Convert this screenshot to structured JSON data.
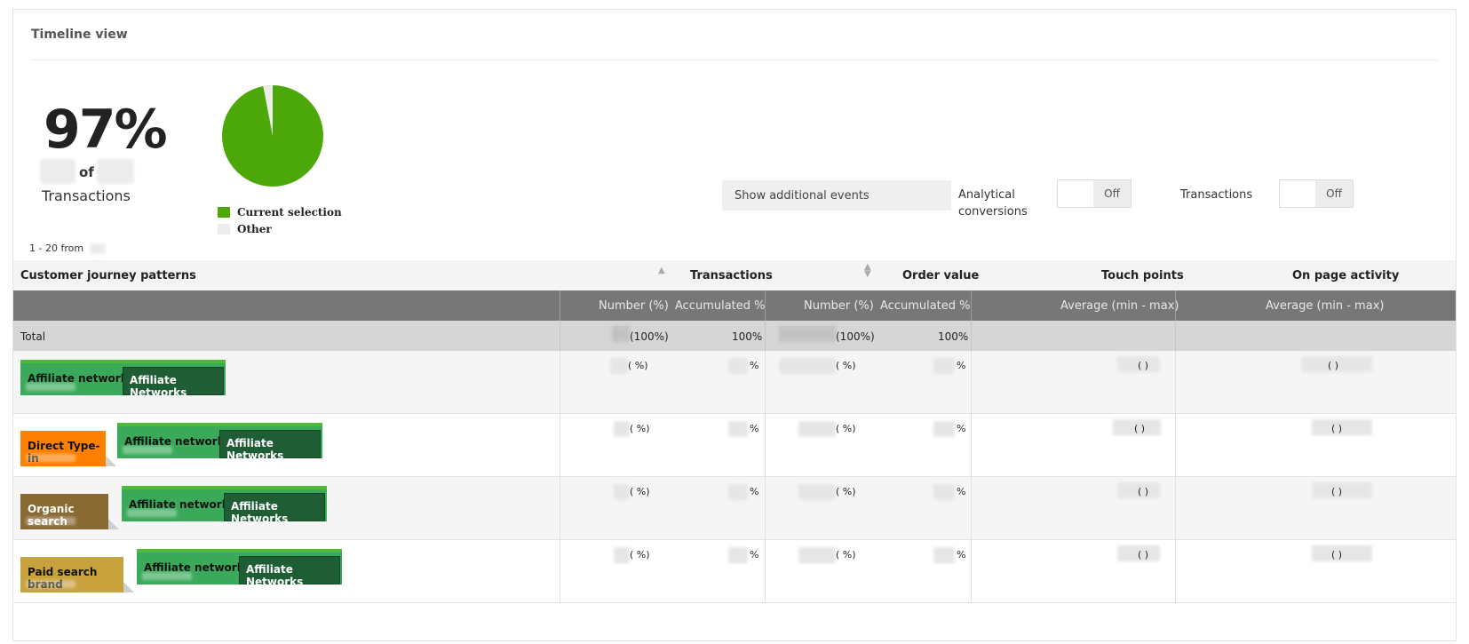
{
  "panel": {
    "title": "Timeline view"
  },
  "summary": {
    "percentage": "97%",
    "of_text": "of",
    "metric_label": "Transactions",
    "range_text": "1 - 20 from"
  },
  "pie_legend": [
    {
      "label": "Current selection",
      "color": "#4ca808"
    },
    {
      "label": "Other",
      "color": "#ececec"
    }
  ],
  "controls": {
    "show_events_label": "Show additional events",
    "toggle1_label": "Analytical conversions",
    "toggle1_state": "Off",
    "toggle2_label": "Transactions",
    "toggle2_state": "Off"
  },
  "table": {
    "group_headers": {
      "patterns": "Customer journey patterns",
      "transactions": "Transactions",
      "order_value": "Order value",
      "touch_points": "Touch points",
      "on_page_activity": "On page activity"
    },
    "sub_headers": {
      "number_pct_1": "Number (%)",
      "accumulated_1": "Accumulated %",
      "number_pct_2": "Number (%)",
      "accumulated_2": "Accumulated %",
      "average_1": "Average (min - max)",
      "average_2": "Average (min - max)"
    },
    "total": {
      "label": "Total",
      "trans_number": "(100%)",
      "trans_accum": "100%",
      "order_number": "(100%)",
      "order_accum": "100%"
    },
    "rows": [
      {
        "chips": [
          {
            "label": "Affiliate networks",
            "inner": "Affiliate Networks"
          }
        ],
        "trans_number": "(   %)",
        "trans_accum": "%",
        "order_number": "(   %)",
        "order_accum": "%",
        "touch": "(   )",
        "activity": "(   )"
      },
      {
        "chips": [
          {
            "label": "Direct Type-in"
          },
          {
            "label": "Affiliate networks",
            "inner": "Affiliate Networks"
          }
        ],
        "trans_number": "(   %)",
        "trans_accum": "%",
        "order_number": "(   %)",
        "order_accum": "%",
        "touch": "(   )",
        "activity": "(   )"
      },
      {
        "chips": [
          {
            "label": "Organic search"
          },
          {
            "label": "Affiliate networks",
            "inner": "Affiliate Networks"
          }
        ],
        "trans_number": "(   %)",
        "trans_accum": "%",
        "order_number": "(   %)",
        "order_accum": "%",
        "touch": "(   )",
        "activity": "(   )"
      },
      {
        "chips": [
          {
            "label": "Paid search brand"
          },
          {
            "label": "Affiliate networks",
            "inner": "Affiliate Networks"
          }
        ],
        "trans_number": "(   %)",
        "trans_accum": "%",
        "order_number": "(   %)",
        "order_accum": "%",
        "touch": "(   )",
        "activity": "(   )"
      }
    ]
  }
}
